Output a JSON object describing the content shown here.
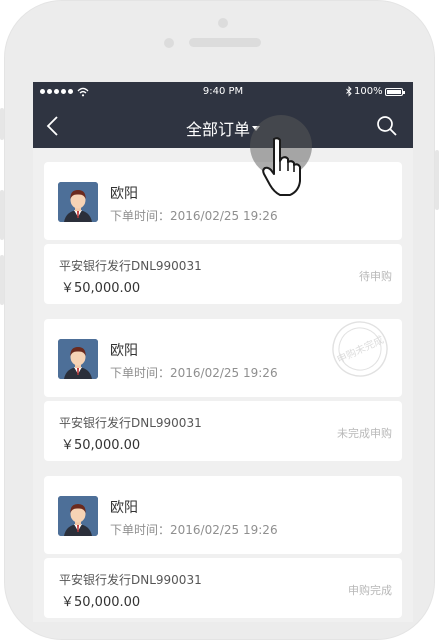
{
  "status_bar": {
    "time": "9:40 PM",
    "battery": "100%"
  },
  "nav": {
    "title": "全部订单",
    "back_icon": "chevron-left-icon",
    "search_icon": "search-icon",
    "dropdown_icon": "caret-down-icon"
  },
  "orders": [
    {
      "name": "欧阳",
      "time_label": "下单时间：",
      "time": "2016/02/25 19:26",
      "product": "平安银行发行DNL990031",
      "amount": "￥50,000.00",
      "status": "待申购"
    },
    {
      "name": "欧阳",
      "time_label": "下单时间：",
      "time": "2016/02/25 19:26",
      "product": "平安银行发行DNL990031",
      "amount": "￥50,000.00",
      "status": "未完成申购",
      "stamp": "申购未完成"
    },
    {
      "name": "欧阳",
      "time_label": "下单时间：",
      "time": "2016/02/25 19:26",
      "product": "平安银行发行DNL990031",
      "amount": "￥50,000.00",
      "status": "申购完成"
    }
  ],
  "colors": {
    "nav_bg": "#2f3441",
    "page_bg": "#f0f0f0",
    "avatar_bg": "#4d6f98"
  }
}
